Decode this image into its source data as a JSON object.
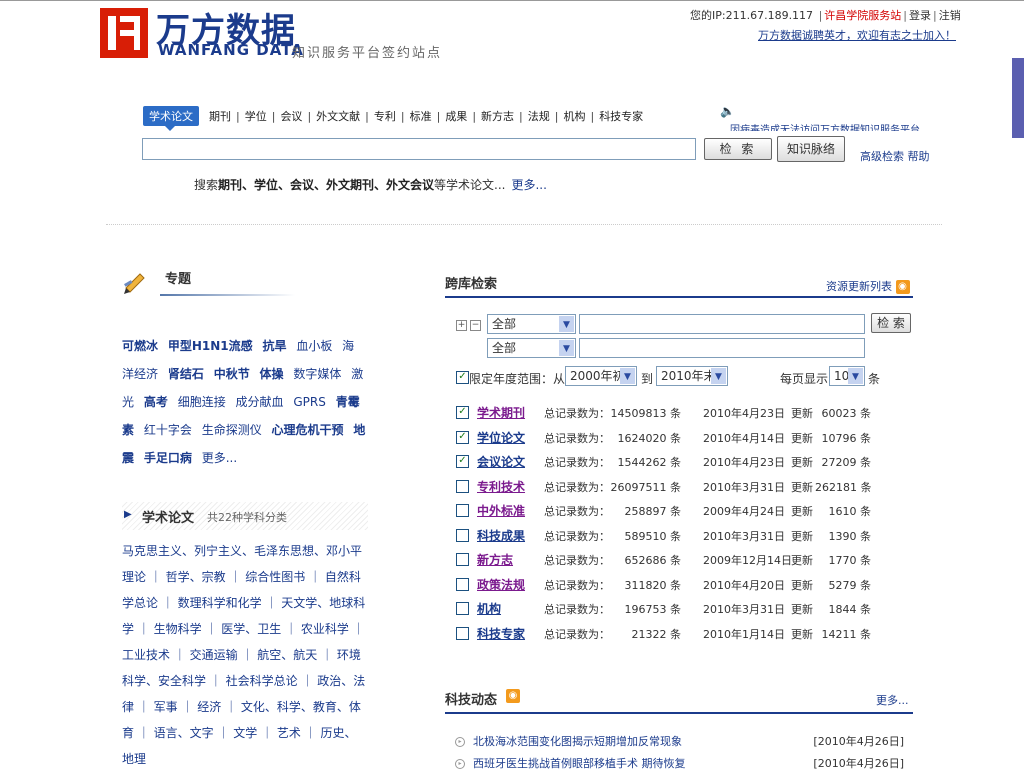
{
  "header": {
    "logo_cn": "万方数据",
    "logo_en": "WANFANG DATA",
    "slogan": "知识服务平台签约站点",
    "ip_prefix": "您的IP:211.67.189.117",
    "site_name": "许昌学院服务站",
    "login": "登录",
    "logout": "注销",
    "recruit": "万方数据诚聘英才，欢迎有志之士加入！"
  },
  "search": {
    "tabs": [
      "学术论文",
      "期刊",
      "学位",
      "会议",
      "外文文献",
      "专利",
      "标准",
      "成果",
      "新方志",
      "法规",
      "机构",
      "科技专家"
    ],
    "marquee": "因病毒造成无法访问万方数据知识服务平台",
    "search_button": "检 索",
    "knowledge_button": "知识脉络",
    "advanced": "高级检索",
    "help": "帮助",
    "hint_prefix": "搜索",
    "hint_bold": "期刊、学位、会议、外文期刊、外文会议",
    "hint_suffix": "等学术论文...",
    "hint_more": "更多..."
  },
  "topics": {
    "title": "专题",
    "items": [
      {
        "t": "可燃冰",
        "b": true
      },
      {
        "t": "甲型H1N1流感",
        "b": true
      },
      {
        "t": "抗旱",
        "b": true
      },
      {
        "t": "血小板",
        "b": false
      },
      {
        "t": "海洋经济",
        "b": false
      },
      {
        "t": "肾结石",
        "b": true
      },
      {
        "t": "中秋节",
        "b": true
      },
      {
        "t": "体操",
        "b": true
      },
      {
        "t": "数字媒体",
        "b": false
      },
      {
        "t": "激光",
        "b": false
      },
      {
        "t": "高考",
        "b": true
      },
      {
        "t": "细胞连接",
        "b": false
      },
      {
        "t": "成分献血",
        "b": false
      },
      {
        "t": "GPRS",
        "b": false
      },
      {
        "t": "青霉素",
        "b": true
      },
      {
        "t": "红十字会",
        "b": false
      },
      {
        "t": "生命探测仪",
        "b": false
      },
      {
        "t": "心理危机干预",
        "b": true
      },
      {
        "t": "地震",
        "b": true
      },
      {
        "t": "手足口病",
        "b": true
      },
      {
        "t": "更多...",
        "b": false
      }
    ]
  },
  "papers": {
    "title": "学术论文",
    "count": "共22种学科分类",
    "subjects": "马克思主义、列宁主义、毛泽东思想、邓小平理论 ｜ 哲学、宗教 ｜ 综合性图书 ｜ 自然科学总论 ｜ 数理科学和化学 ｜ 天文学、地球科学 ｜ 生物科学 ｜ 医学、卫生 ｜ 农业科学 ｜ 工业技术 ｜ 交通运输 ｜ 航空、航天 ｜ 环境科学、安全科学 ｜ 社会科学总论 ｜ 政治、法律 ｜ 军事 ｜ 经济 ｜ 文化、科学、教育、体育 ｜ 语言、文字 ｜ 文学 ｜ 艺术 ｜ 历史、地理"
  },
  "cross": {
    "title": "跨库检索",
    "resource_link": "资源更新列表",
    "scope1": "全部",
    "scope2": "全部",
    "search_button": "检 索",
    "year_label": "限定年度范围：",
    "from": "从",
    "from_value": "2000年初",
    "to": "到",
    "to_value": "2010年末",
    "per_page": "每页显示",
    "per_page_value": "10",
    "unit": "条",
    "databases": [
      {
        "name": "学术期刊",
        "checked": true,
        "label": "总记录数为：",
        "count": "14509813 条",
        "date": "2010年4月23日",
        "upd": "更新",
        "ucount": "60023 条",
        "purple": true
      },
      {
        "name": "学位论文",
        "checked": true,
        "label": "总记录数为：",
        "count": "1624020 条",
        "date": "2010年4月14日",
        "upd": "更新",
        "ucount": "10796 条",
        "purple": false
      },
      {
        "name": "会议论文",
        "checked": true,
        "label": "总记录数为：",
        "count": "1544262 条",
        "date": "2010年4月23日",
        "upd": "更新",
        "ucount": "27209 条",
        "purple": false
      },
      {
        "name": "专利技术",
        "checked": false,
        "label": "总记录数为：",
        "count": "26097511 条",
        "date": "2010年3月31日",
        "upd": "更新",
        "ucount": "262181 条",
        "purple": true
      },
      {
        "name": "中外标准",
        "checked": false,
        "label": "总记录数为：",
        "count": "258897 条",
        "date": "2009年4月24日",
        "upd": "更新",
        "ucount": "1610 条",
        "purple": true
      },
      {
        "name": "科技成果",
        "checked": false,
        "label": "总记录数为：",
        "count": "589510 条",
        "date": "2010年3月31日",
        "upd": "更新",
        "ucount": "1390 条",
        "purple": false
      },
      {
        "name": "新方志",
        "checked": false,
        "label": "总记录数为：",
        "count": "652686 条",
        "date": "2009年12月14日",
        "upd": "更新",
        "ucount": "1770 条",
        "purple": true
      },
      {
        "name": "政策法规",
        "checked": false,
        "label": "总记录数为：",
        "count": "311820 条",
        "date": "2010年4月20日",
        "upd": "更新",
        "ucount": "5279 条",
        "purple": true
      },
      {
        "name": "机构",
        "checked": false,
        "label": "总记录数为：",
        "count": "196753 条",
        "date": "2010年3月31日",
        "upd": "更新",
        "ucount": "1844 条",
        "purple": false
      },
      {
        "name": "科技专家",
        "checked": false,
        "label": "总记录数为：",
        "count": "21322 条",
        "date": "2010年1月14日",
        "upd": "更新",
        "ucount": "14211 条",
        "purple": false
      }
    ]
  },
  "news": {
    "title": "科技动态",
    "more": "更多...",
    "items": [
      {
        "text": "北极海冰范围变化图揭示短期增加反常现象",
        "date": "[2010年4月26日]"
      },
      {
        "text": "西班牙医生挑战首例眼部移植手术 期待恢复",
        "date": "[2010年4月26日]"
      }
    ]
  },
  "colors": {
    "brand_red": "#d81e06",
    "brand_blue": "#1b3b8c",
    "tab_blue": "#2c6cc6"
  }
}
